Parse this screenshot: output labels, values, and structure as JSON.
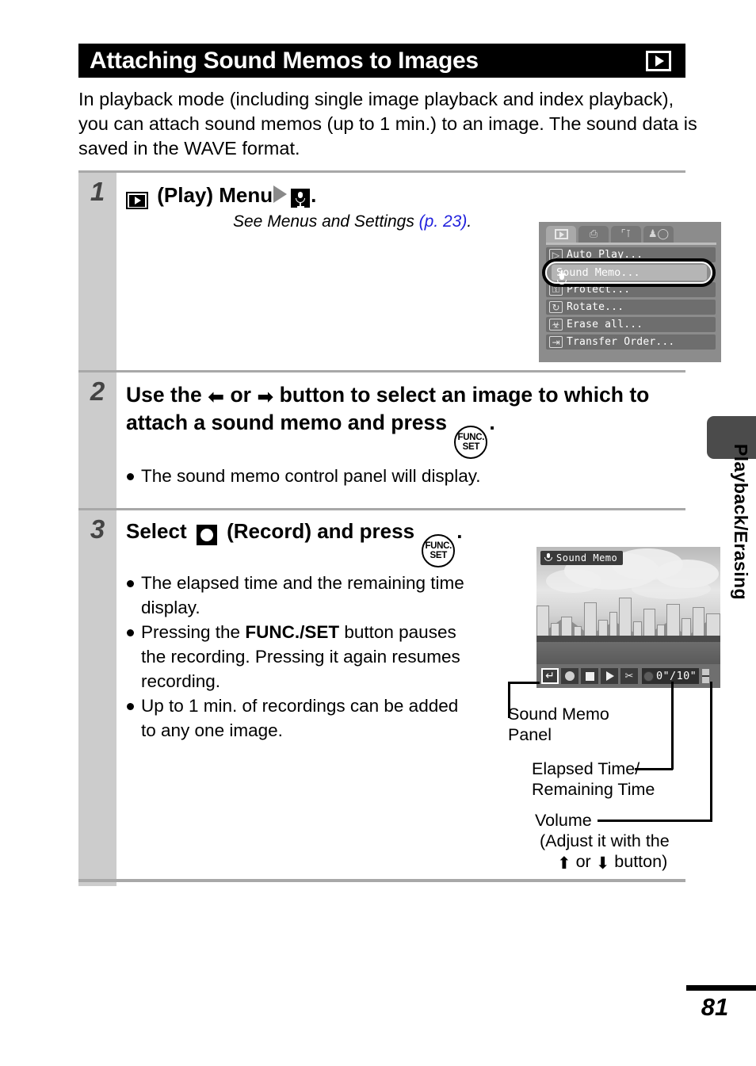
{
  "header": {
    "title": "Attaching Sound Memos to Images",
    "icon": "playback-mode-icon"
  },
  "intro": "In playback mode (including single image playback and index playback), you can attach sound memos (up to 1 min.) to an image. The sound data is saved in the WAVE format.",
  "steps": [
    {
      "number": "1",
      "heading_prefix": "(Play) Menu",
      "heading_suffix": ".",
      "note": {
        "text": "See Menus and Settings ",
        "link": "(p. 23)",
        "tail": "."
      },
      "camera_menu": {
        "tabs": [
          {
            "name": "playback-tab",
            "glyph": "▶",
            "active": true
          },
          {
            "name": "print-tab",
            "glyph": "⎙",
            "active": false
          },
          {
            "name": "setup-tab",
            "glyph": "††",
            "active": false
          },
          {
            "name": "my-camera-tab",
            "glyph": "♟",
            "active": false
          }
        ],
        "items": [
          {
            "label": "Auto Play...",
            "icon": "▷",
            "selected": false
          },
          {
            "label": "Sound Memo...",
            "icon": " ",
            "selected": true
          },
          {
            "label": "Protect...",
            "icon": "⚿",
            "selected": false
          },
          {
            "label": "Rotate...",
            "icon": "↻",
            "selected": false
          },
          {
            "label": "Erase all...",
            "icon": "☠",
            "selected": false
          },
          {
            "label": "Transfer Order...",
            "icon": "⇥",
            "selected": false
          }
        ]
      }
    },
    {
      "number": "2",
      "heading_part1": "Use the",
      "heading_or": "or",
      "heading_part2": "button to select an image to which to attach a sound memo and press",
      "heading_period": ".",
      "bullets": [
        "The sound memo control panel will display."
      ]
    },
    {
      "number": "3",
      "heading_part1": "Select",
      "heading_part2": "(Record) and press",
      "heading_period": ".",
      "bullets": [
        "The elapsed time and the remaining time display.",
        "Pressing the FUNC./SET button pauses the recording. Pressing it again resumes recording.",
        "Up to 1 min. of recordings can be added to any one image."
      ],
      "bullet2": {
        "pre": "Pressing the ",
        "bold": "FUNC./SET",
        "post": " button pauses the recording. Pressing it again resumes recording."
      },
      "camera_photo": {
        "badge_label": "Sound Memo",
        "panel_buttons": [
          {
            "name": "exit-button",
            "selected": true
          },
          {
            "name": "record-button",
            "selected": false
          },
          {
            "name": "stop-button",
            "selected": false
          },
          {
            "name": "play-button",
            "selected": false
          },
          {
            "name": "erase-button",
            "selected": false
          }
        ],
        "time_display": "0\"/10\"",
        "volume": "volume-level-indicator"
      },
      "callouts": [
        {
          "name": "sound-memo-panel-callout",
          "line1": "Sound Memo",
          "line2": "Panel"
        },
        {
          "name": "elapsed-time-callout",
          "line1": "Elapsed Time/",
          "line2": "Remaining Time"
        },
        {
          "name": "volume-callout",
          "line1": "Volume",
          "line2": "(Adjust it with the",
          "line3_or": "or",
          "line3_tail": "button)"
        }
      ]
    }
  ],
  "func_set_button": {
    "line1": "FUNC.",
    "line2": "SET"
  },
  "side_tab": {
    "label": "Playback/Erasing"
  },
  "footer": {
    "page_number": "81"
  },
  "colors": {
    "title_bar_bg": "#000000",
    "step_number_bg": "#cccccc",
    "step_number_fg": "#444444",
    "rule": "#a8a8a8",
    "link_blue": "#2222dd",
    "side_tab_block": "#4b4b4b"
  }
}
